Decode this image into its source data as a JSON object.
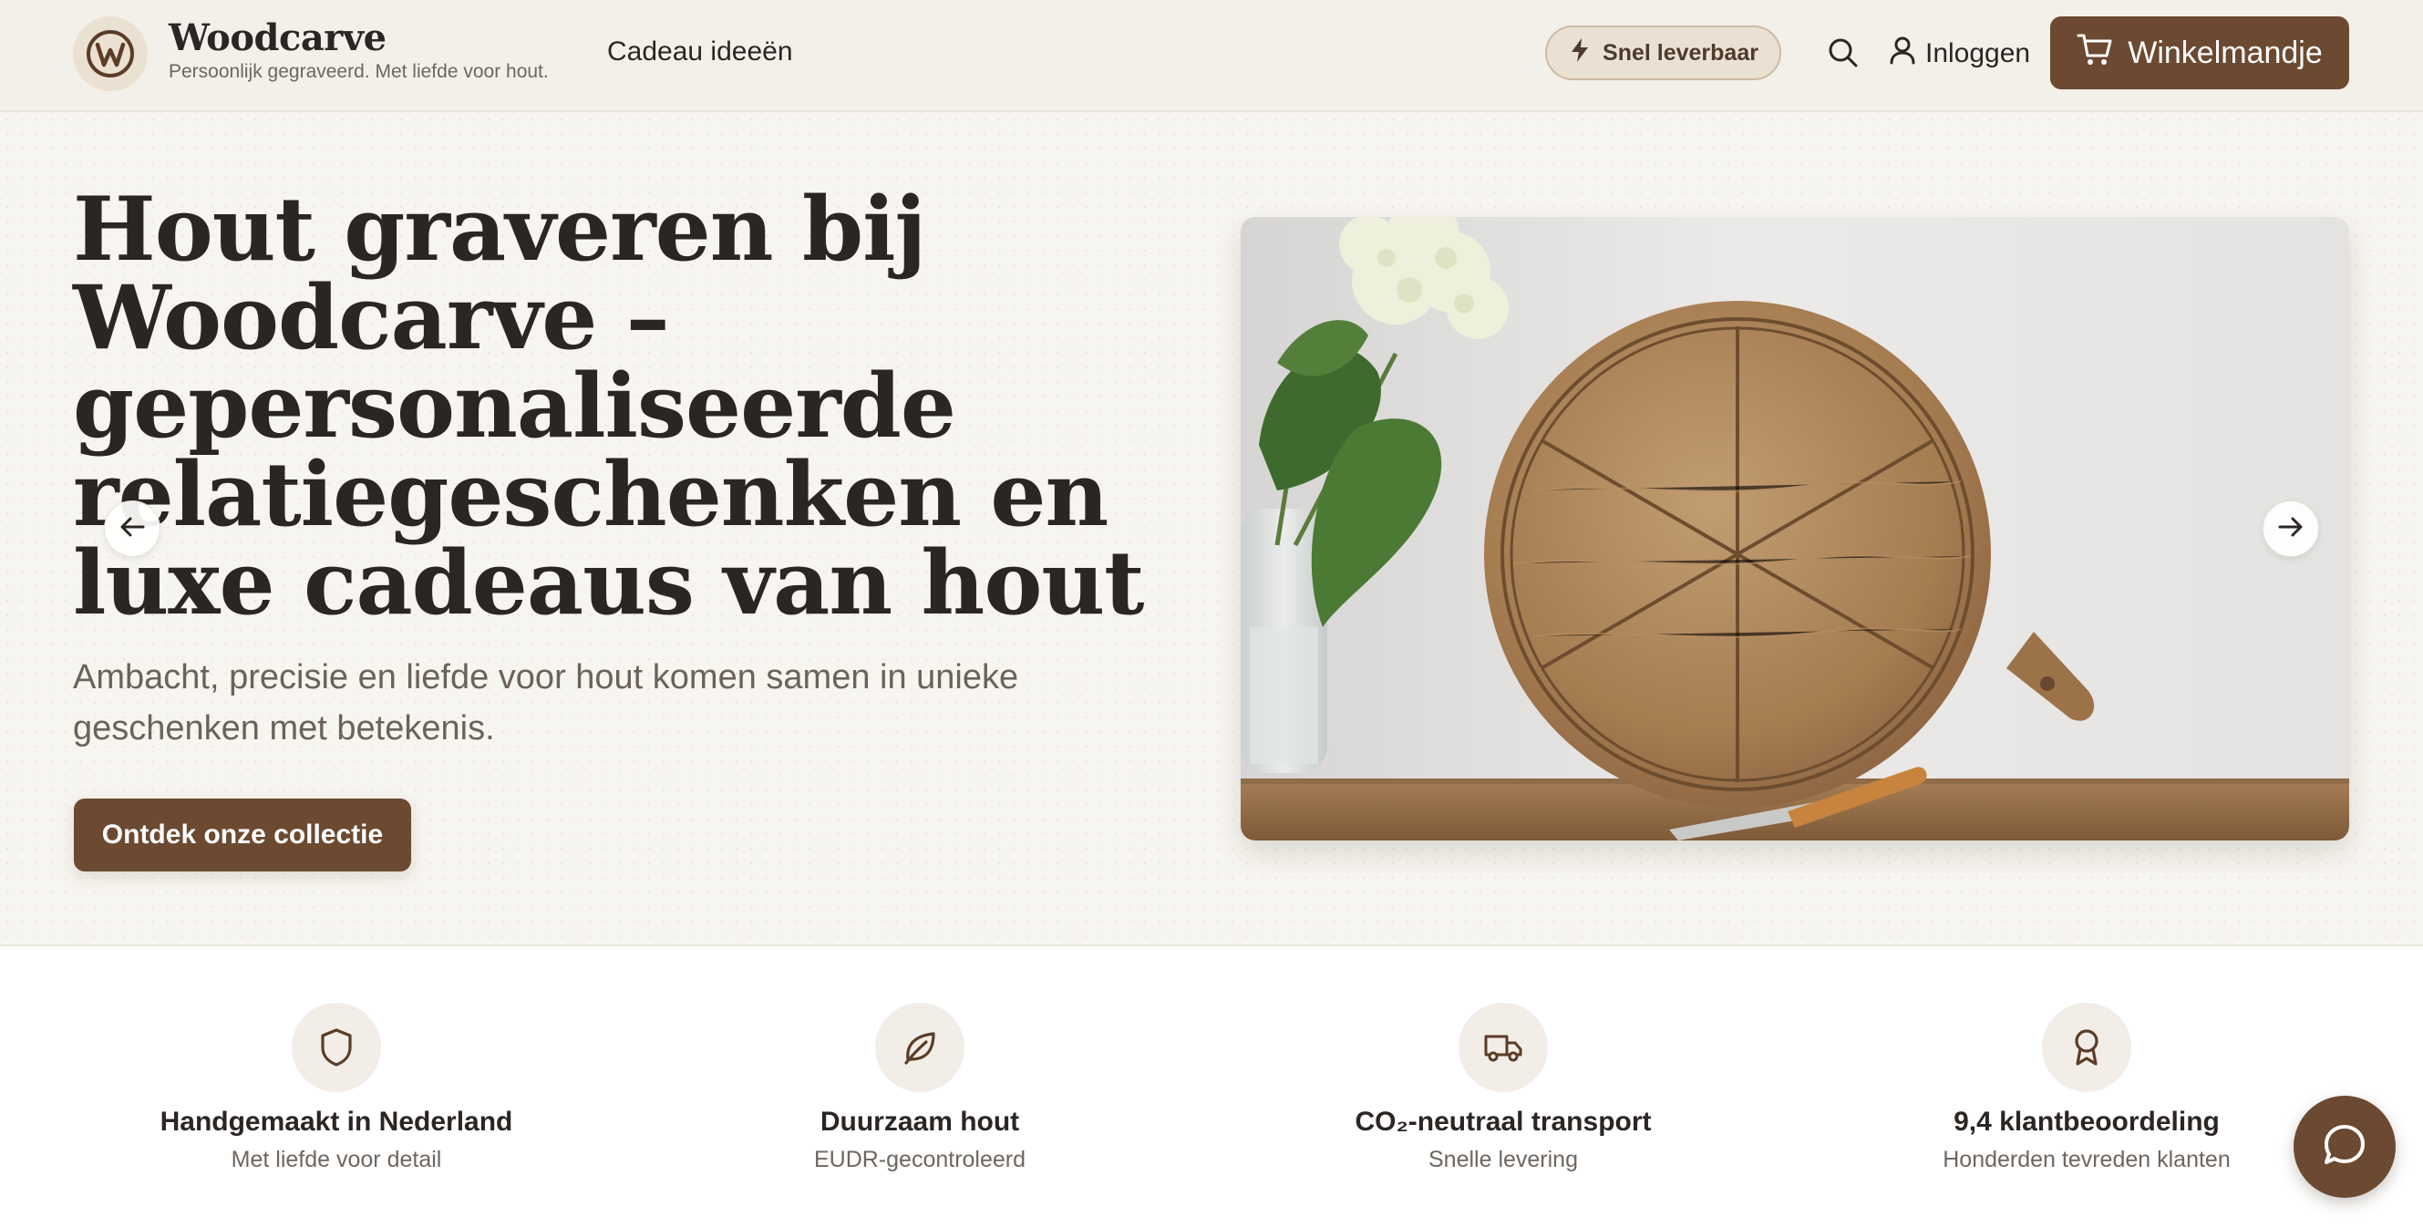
{
  "header": {
    "brand_name": "Woodcarve",
    "brand_tagline": "Persoonlijk gegraveerd. Met liefde voor hout.",
    "nav_gift_ideas": "Cadeau ideeën",
    "quick_delivery_label": "Snel leverbaar",
    "login_label": "Inloggen",
    "cart_label": "Winkelmandje"
  },
  "hero": {
    "title": "Hout graveren bij Woodcarve – gepersonaliseerde relatiegeschenken en luxe cadeaus van hout",
    "subtitle": "Ambacht, precisie en liefde voor hout komen samen in unieke geschenken met betekenis.",
    "cta_label": "Ontdek onze collectie"
  },
  "features": [
    {
      "title": "Handgemaakt in Nederland",
      "desc": "Met liefde voor detail",
      "icon": "shield-icon"
    },
    {
      "title": "Duurzaam hout",
      "desc": "EUDR-gecontroleerd",
      "icon": "leaf-icon"
    },
    {
      "title": "CO₂-neutraal transport",
      "desc": "Snelle levering",
      "icon": "truck-icon"
    },
    {
      "title": "9,4 klantbeoordeling",
      "desc": "Honderden tevreden klanten",
      "icon": "award-icon"
    }
  ],
  "colors": {
    "brand_brown": "#6b4a31",
    "header_bg": "#f3efe9",
    "hero_bg": "#f7f5f0"
  }
}
